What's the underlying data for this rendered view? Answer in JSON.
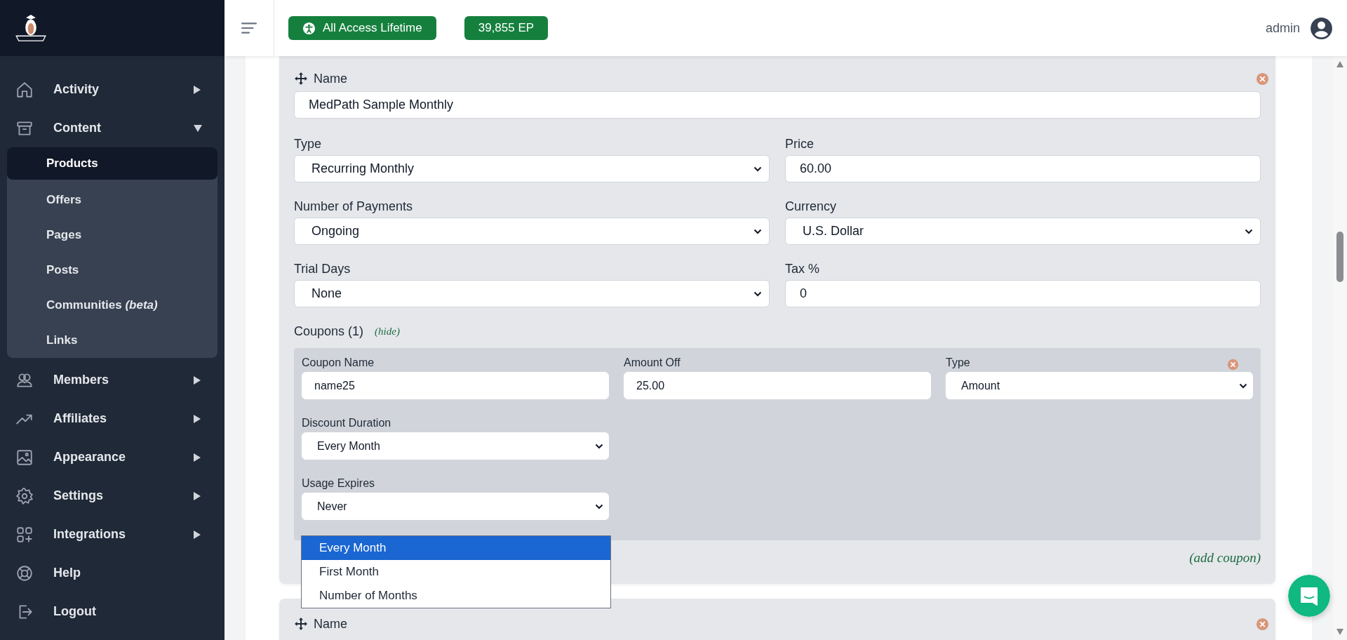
{
  "sidebar": {
    "items": [
      {
        "label": "Activity",
        "kind": "group",
        "expanded": false
      },
      {
        "label": "Content",
        "kind": "group",
        "expanded": true,
        "children": [
          {
            "label": "Products",
            "selected": true
          },
          {
            "label": "Offers",
            "selected": false
          },
          {
            "label": "Pages",
            "selected": false
          },
          {
            "label": "Posts",
            "selected": false
          },
          {
            "label": "Communities *(beta)*",
            "selected": false
          },
          {
            "label": "Links",
            "selected": false
          }
        ]
      },
      {
        "label": "Members",
        "kind": "group",
        "expanded": false
      },
      {
        "label": "Affiliates",
        "kind": "group",
        "expanded": false
      },
      {
        "label": "Appearance",
        "kind": "group",
        "expanded": false
      },
      {
        "label": "Settings",
        "kind": "group",
        "expanded": false
      },
      {
        "label": "Integrations",
        "kind": "group",
        "expanded": false
      },
      {
        "label": "Help",
        "kind": "link"
      },
      {
        "label": "Logout",
        "kind": "link"
      }
    ]
  },
  "topbar": {
    "badges": [
      {
        "label": "All Access Lifetime",
        "kind": "access"
      },
      {
        "label": "39,855 EP",
        "kind": "points"
      }
    ],
    "user": "admin"
  },
  "products": [
    {
      "name_label": "Name",
      "name": "MedPath Sample Monthly",
      "fields": [
        {
          "label": "Type",
          "value": "Recurring Monthly",
          "kind": "select"
        },
        {
          "label": "Price",
          "value": "60.00",
          "kind": "input"
        },
        {
          "label": "Number of Payments",
          "value": "Ongoing",
          "kind": "select"
        },
        {
          "label": "Currency",
          "value": "U.S. Dollar",
          "kind": "select"
        },
        {
          "label": "Trial Days",
          "value": "None",
          "kind": "select"
        },
        {
          "label": "Tax %",
          "value": "0",
          "kind": "input"
        }
      ],
      "coupons_label": "Coupons (1)",
      "coupons_toggle": "(hide)",
      "coupons": [
        {
          "fields": [
            {
              "label": "Coupon Name",
              "value": "name25",
              "kind": "input"
            },
            {
              "label": "Amount Off",
              "value": "25.00",
              "kind": "input"
            },
            {
              "label": "Type",
              "value": "Amount",
              "kind": "select"
            },
            {
              "label": "Discount Duration",
              "value": "Every Month",
              "kind": "select"
            },
            {
              "label": "Usage Expires",
              "value": "Never",
              "kind": "select"
            }
          ]
        }
      ],
      "add_coupon": "(add coupon)"
    },
    {
      "name_label": "Name"
    }
  ],
  "open_dropdown": {
    "options": [
      {
        "label": "Every Month",
        "selected": true
      },
      {
        "label": "First Month",
        "selected": false
      },
      {
        "label": "Number of Months",
        "selected": false
      }
    ]
  }
}
